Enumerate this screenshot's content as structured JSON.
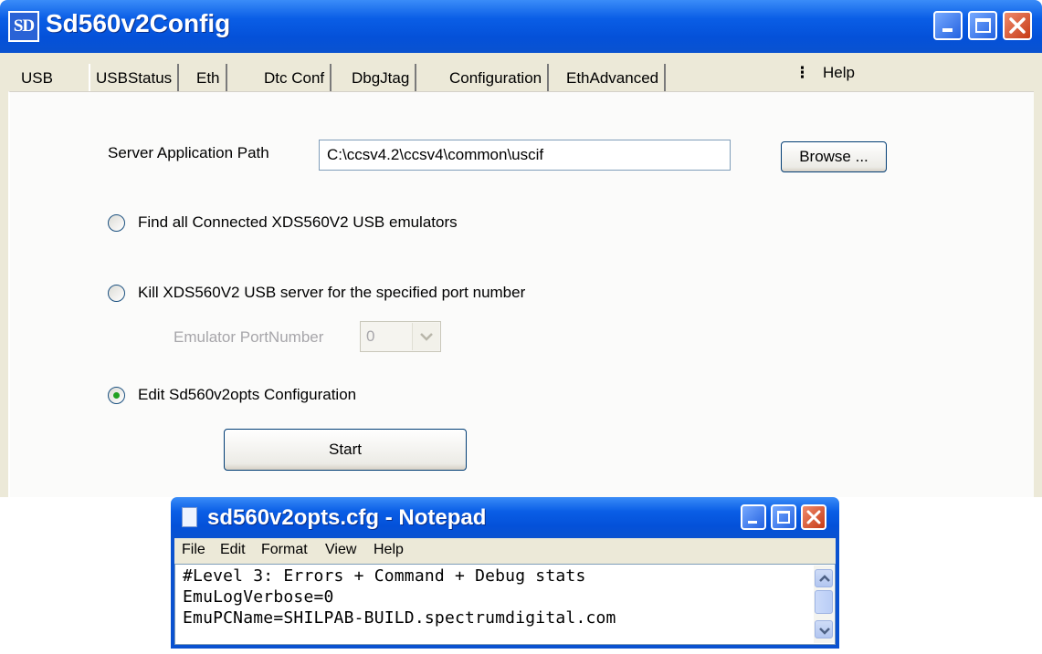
{
  "main_window": {
    "app_icon_text": "SD",
    "title": "Sd560v2Config",
    "tabs": [
      "USB",
      "USBStatus",
      "Eth",
      "Dtc Conf",
      "DbgJtag",
      "Configuration",
      "EthAdvanced"
    ],
    "active_tab": "USB",
    "help_menu": "Help",
    "server_path_label": "Server Application Path",
    "server_path_value": "C:\\ccsv4.2\\ccsv4\\common\\uscif",
    "browse_label": "Browse ...",
    "options": {
      "find_all": {
        "label": "Find all Connected XDS560V2 USB emulators",
        "checked": false
      },
      "kill_server": {
        "label": "Kill XDS560V2 USB server for the specified port number",
        "checked": false
      },
      "edit_config": {
        "label": "Edit Sd560v2opts Configuration",
        "checked": true
      }
    },
    "port_label": "Emulator PortNumber",
    "port_value": "0",
    "start_label": "Start"
  },
  "notepad": {
    "title": "sd560v2opts.cfg - Notepad",
    "menus": [
      "File",
      "Edit",
      "Format",
      "View",
      "Help"
    ],
    "lines": [
      "#Level 3: Errors + Command + Debug stats",
      "EmuLogVerbose=0",
      "EmuPCName=SHILPAB-BUILD.spectrumdigital.com"
    ]
  },
  "colors": {
    "titlebar_blue": "#0a5ee6",
    "close_red": "#c63b16",
    "dialog_face": "#ece9d8",
    "radio_checked": "#21a121"
  }
}
